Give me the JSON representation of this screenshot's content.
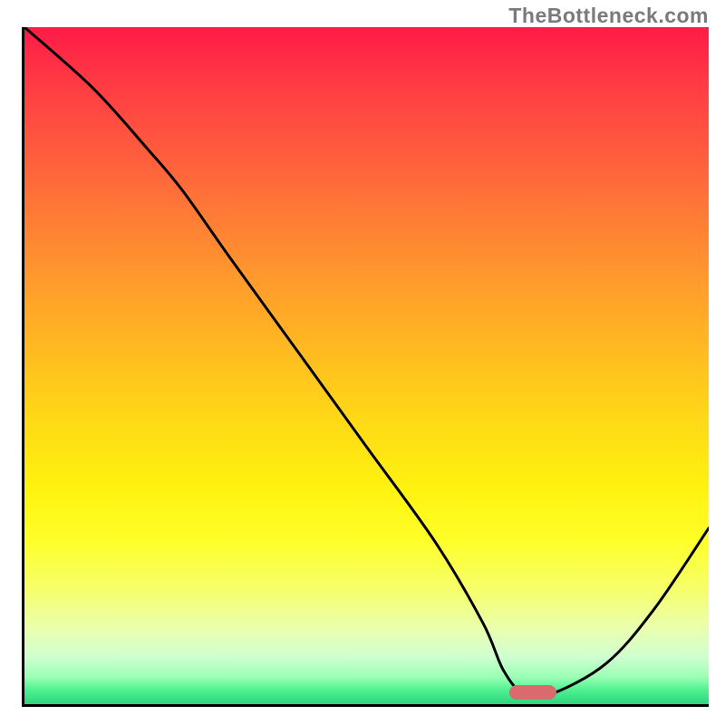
{
  "watermark": "TheBottleneck.com",
  "chart_data": {
    "type": "line",
    "title": "",
    "xlabel": "",
    "ylabel": "",
    "xlim": [
      0,
      100
    ],
    "ylim": [
      0,
      100
    ],
    "grid": false,
    "legend": false,
    "background_gradient": {
      "top": "#ff1a47",
      "middle": "#ffd916",
      "bottom": "#2ed47e"
    },
    "series": [
      {
        "name": "bottleneck-curve",
        "x": [
          0,
          10,
          18,
          23,
          30,
          40,
          50,
          60,
          67,
          70,
          73,
          77,
          85,
          92,
          100
        ],
        "y": [
          100,
          91,
          82,
          76,
          66,
          52,
          38,
          24,
          12,
          5,
          1.5,
          1.5,
          6,
          14,
          26
        ],
        "color": "#000000"
      }
    ],
    "marker": {
      "name": "optimal-range",
      "x": 74,
      "y": 2.2,
      "color": "#d96a6d",
      "shape": "pill"
    }
  }
}
